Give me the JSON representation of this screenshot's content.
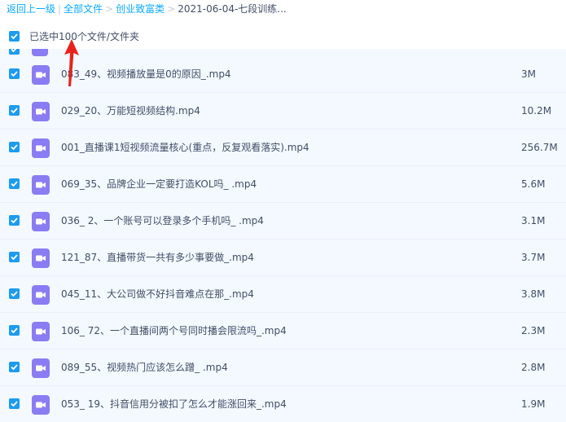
{
  "breadcrumb": {
    "back": "返回上一级",
    "items": [
      "全部文件",
      "创业致富类",
      "2021-06-04-七段训练..."
    ]
  },
  "selection": {
    "text": "已选中100个文件/文件夹"
  },
  "files": [
    {
      "name": "083_49、视频播放量是0的原因_.mp4",
      "size": "3M"
    },
    {
      "name": "029_20、万能短视频结构.mp4",
      "size": "10.2M"
    },
    {
      "name": "001_直播课1短视频流量核心(重点，反复观看落实).mp4",
      "size": "256.7M"
    },
    {
      "name": "069_35、品牌企业一定要打造KOL吗_ .mp4",
      "size": "5.6M"
    },
    {
      "name": "036_ 2、一个账号可以登录多个手机吗_ .mp4",
      "size": "3.1M"
    },
    {
      "name": "121_87、直播带货一共有多少事要做_.mp4",
      "size": "3.7M"
    },
    {
      "name": "045_11、大公司做不好抖音难点在那_.mp4",
      "size": "3.8M"
    },
    {
      "name": "106_ 72、一个直播间两个号同时播会限流吗_.mp4",
      "size": "2.3M"
    },
    {
      "name": "089_55、视频热门应该怎么蹭_ .mp4",
      "size": "2.8M"
    },
    {
      "name": "053_ 19、抖音信用分被扣了怎么才能涨回来_.mp4",
      "size": "1.9M"
    }
  ],
  "colors": {
    "accent": "#09aaff",
    "checkbox": "#1c9bf0",
    "video_icon": "#8a7cf2",
    "arrow": "#e8221b"
  }
}
